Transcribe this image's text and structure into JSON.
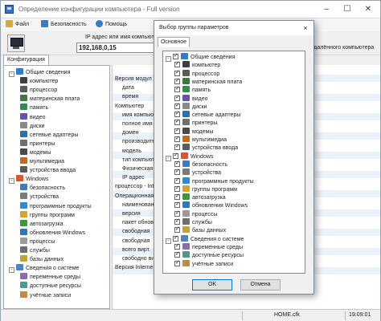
{
  "window": {
    "title": "Определение конфигурации компьютера - Full version"
  },
  "menu": [
    "Файл",
    "Безопасность",
    "Помощь"
  ],
  "toolbar": {
    "ip_label": "IP адрес или имя компьютера",
    "ip_value": "192,168,0,15",
    "remote_label": "удалённого компьютера"
  },
  "tab": "Конфигурация",
  "tree": [
    {
      "label": "Общие сведения",
      "level": 0,
      "icon": "info-icon",
      "expander": "-"
    },
    {
      "label": "компьютер",
      "level": 1,
      "icon": "computer-icon"
    },
    {
      "label": "процессор",
      "level": 1,
      "icon": "processor-icon"
    },
    {
      "label": "материнская плата",
      "level": 1,
      "icon": "motherboard-icon"
    },
    {
      "label": "память",
      "level": 1,
      "icon": "memory-icon"
    },
    {
      "label": "видео",
      "level": 1,
      "icon": "video-icon"
    },
    {
      "label": "диски",
      "level": 1,
      "icon": "disk-icon"
    },
    {
      "label": "сетевые адаптеры",
      "level": 1,
      "icon": "network-icon"
    },
    {
      "label": "принтеры",
      "level": 1,
      "icon": "printer-icon"
    },
    {
      "label": "модемы",
      "level": 1,
      "icon": "modem-icon"
    },
    {
      "label": "мультимедиа",
      "level": 1,
      "icon": "multimedia-icon"
    },
    {
      "label": "устройства ввода",
      "level": 1,
      "icon": "input-device-icon"
    },
    {
      "label": "Windows",
      "level": 0,
      "icon": "windows-icon",
      "expander": "-"
    },
    {
      "label": "безопасность",
      "level": 1,
      "icon": "shield-icon"
    },
    {
      "label": "устройства",
      "level": 1,
      "icon": "devices-icon"
    },
    {
      "label": "программные продукты",
      "level": 1,
      "icon": "software-icon"
    },
    {
      "label": "группы программ",
      "level": 1,
      "icon": "program-groups-icon"
    },
    {
      "label": "автозагрузка",
      "level": 1,
      "icon": "autorun-icon"
    },
    {
      "label": "обновления Windows",
      "level": 1,
      "icon": "updates-icon"
    },
    {
      "label": "процессы",
      "level": 1,
      "icon": "processes-icon"
    },
    {
      "label": "службы",
      "level": 1,
      "icon": "services-icon"
    },
    {
      "label": "базы данных",
      "level": 1,
      "icon": "database-icon"
    },
    {
      "label": "Сведения о системе",
      "level": 0,
      "icon": "system-info-icon",
      "expander": "-"
    },
    {
      "label": "переменные среды",
      "level": 1,
      "icon": "env-vars-icon"
    },
    {
      "label": "доступные ресурсы",
      "level": 1,
      "icon": "resources-icon"
    },
    {
      "label": "учётные записи",
      "level": 1,
      "icon": "accounts-icon"
    }
  ],
  "detail": {
    "lines": [
      {
        "text": "Версия модул",
        "indent": 0
      },
      {
        "text": "дата",
        "indent": 1
      },
      {
        "text": "время",
        "indent": 1
      },
      {
        "text": "Компьютер",
        "indent": 0
      },
      {
        "text": "имя компьютера",
        "indent": 1
      },
      {
        "text": "полное имя ко",
        "indent": 1
      },
      {
        "text": "домен",
        "indent": 1
      },
      {
        "text": "производитель",
        "indent": 1
      },
      {
        "text": "модель",
        "indent": 1
      },
      {
        "text": "тип компьютер",
        "indent": 1
      },
      {
        "text": "Физическая",
        "indent": 1
      },
      {
        "text": "IP адрес",
        "indent": 1
      },
      {
        "text": "процессор - Int",
        "indent": 0
      },
      {
        "text": "Операционная",
        "indent": 0
      },
      {
        "text": "наименование",
        "indent": 1
      },
      {
        "text": "версия",
        "indent": 1
      },
      {
        "text": "пакет обновл",
        "indent": 1
      },
      {
        "text": "свободная",
        "indent": 1
      },
      {
        "text": "свободная",
        "indent": 1
      },
      {
        "text": "всего вирт.",
        "indent": 1
      },
      {
        "text": "свободно вир",
        "indent": 1
      },
      {
        "text": "Версия Interne",
        "indent": 0
      }
    ]
  },
  "status": {
    "file": "HOME.cfk",
    "time": "19:09:01"
  },
  "dialog": {
    "title": "Выбор группы параметров",
    "close_glyph": "×",
    "tab": "Основное",
    "ok": "OK",
    "cancel": "Отмена",
    "items": [
      {
        "label": "Общие сведения",
        "level": 0,
        "checked": true,
        "icon": "info-icon",
        "expander": "-"
      },
      {
        "label": "компьютер",
        "level": 1,
        "checked": true,
        "icon": "computer-icon"
      },
      {
        "label": "процессор",
        "level": 1,
        "checked": true,
        "icon": "processor-icon"
      },
      {
        "label": "материнская плата",
        "level": 1,
        "checked": true,
        "icon": "motherboard-icon"
      },
      {
        "label": "память",
        "level": 1,
        "checked": true,
        "icon": "memory-icon"
      },
      {
        "label": "видео",
        "level": 1,
        "checked": true,
        "icon": "video-icon"
      },
      {
        "label": "диски",
        "level": 1,
        "checked": true,
        "icon": "disk-icon"
      },
      {
        "label": "сетевые адаптеры",
        "level": 1,
        "checked": true,
        "icon": "network-icon"
      },
      {
        "label": "принтеры",
        "level": 1,
        "checked": true,
        "icon": "printer-icon"
      },
      {
        "label": "модемы",
        "level": 1,
        "checked": true,
        "icon": "modem-icon"
      },
      {
        "label": "мультимедиа",
        "level": 1,
        "checked": true,
        "icon": "multimedia-icon"
      },
      {
        "label": "устройства ввода",
        "level": 1,
        "checked": true,
        "icon": "input-device-icon"
      },
      {
        "label": "Windows",
        "level": 0,
        "checked": true,
        "icon": "windows-icon",
        "expander": "-"
      },
      {
        "label": "безопасность",
        "level": 1,
        "checked": true,
        "icon": "shield-icon"
      },
      {
        "label": "устройства",
        "level": 1,
        "checked": true,
        "icon": "devices-icon"
      },
      {
        "label": "программные продукты",
        "level": 1,
        "checked": true,
        "icon": "software-icon"
      },
      {
        "label": "группы программ",
        "level": 1,
        "checked": true,
        "icon": "program-groups-icon"
      },
      {
        "label": "автозагрузка",
        "level": 1,
        "checked": true,
        "icon": "autorun-icon"
      },
      {
        "label": "обновления Windows",
        "level": 1,
        "checked": true,
        "icon": "updates-icon"
      },
      {
        "label": "процессы",
        "level": 1,
        "checked": true,
        "icon": "processes-icon"
      },
      {
        "label": "службы",
        "level": 1,
        "checked": true,
        "icon": "services-icon"
      },
      {
        "label": "базы данных",
        "level": 1,
        "checked": true,
        "icon": "database-icon"
      },
      {
        "label": "Сведения о системе",
        "level": 0,
        "checked": true,
        "icon": "system-info-icon",
        "expander": "-"
      },
      {
        "label": "переменные среды",
        "level": 1,
        "checked": true,
        "icon": "env-vars-icon"
      },
      {
        "label": "доступные ресурсы",
        "level": 1,
        "checked": true,
        "icon": "resources-icon"
      },
      {
        "label": "учётные записи",
        "level": 1,
        "checked": true,
        "icon": "accounts-icon"
      }
    ]
  },
  "icon_colors": {
    "info-icon": "#2e7dd1",
    "computer-icon": "#3a3f4a",
    "processor-icon": "#5a5a5a",
    "motherboard-icon": "#3c7a3c",
    "memory-icon": "#2f8f4e",
    "video-icon": "#6a4fb3",
    "disk-icon": "#8a8a8a",
    "network-icon": "#2a6fb0",
    "printer-icon": "#707070",
    "modem-icon": "#4a4a4a",
    "multimedia-icon": "#c46a1f",
    "input-device-icon": "#5b5b5b",
    "windows-icon": "#e0542b",
    "shield-icon": "#3d7bc9",
    "devices-icon": "#7a7a7a",
    "software-icon": "#2f8ad1",
    "program-groups-icon": "#d9a520",
    "autorun-icon": "#3a9a3a",
    "updates-icon": "#2b78c2",
    "processes-icon": "#9a9a9a",
    "services-icon": "#6e6e6e",
    "database-icon": "#c9a227",
    "system-info-icon": "#4b86c4",
    "env-vars-icon": "#8c6bb0",
    "resources-icon": "#4a9a8a",
    "accounts-icon": "#c58b3a",
    "file-menu-icon": "#d6a93a",
    "security-menu-icon": "#3d7bc9",
    "help-menu-icon": "#2e7dd1"
  }
}
